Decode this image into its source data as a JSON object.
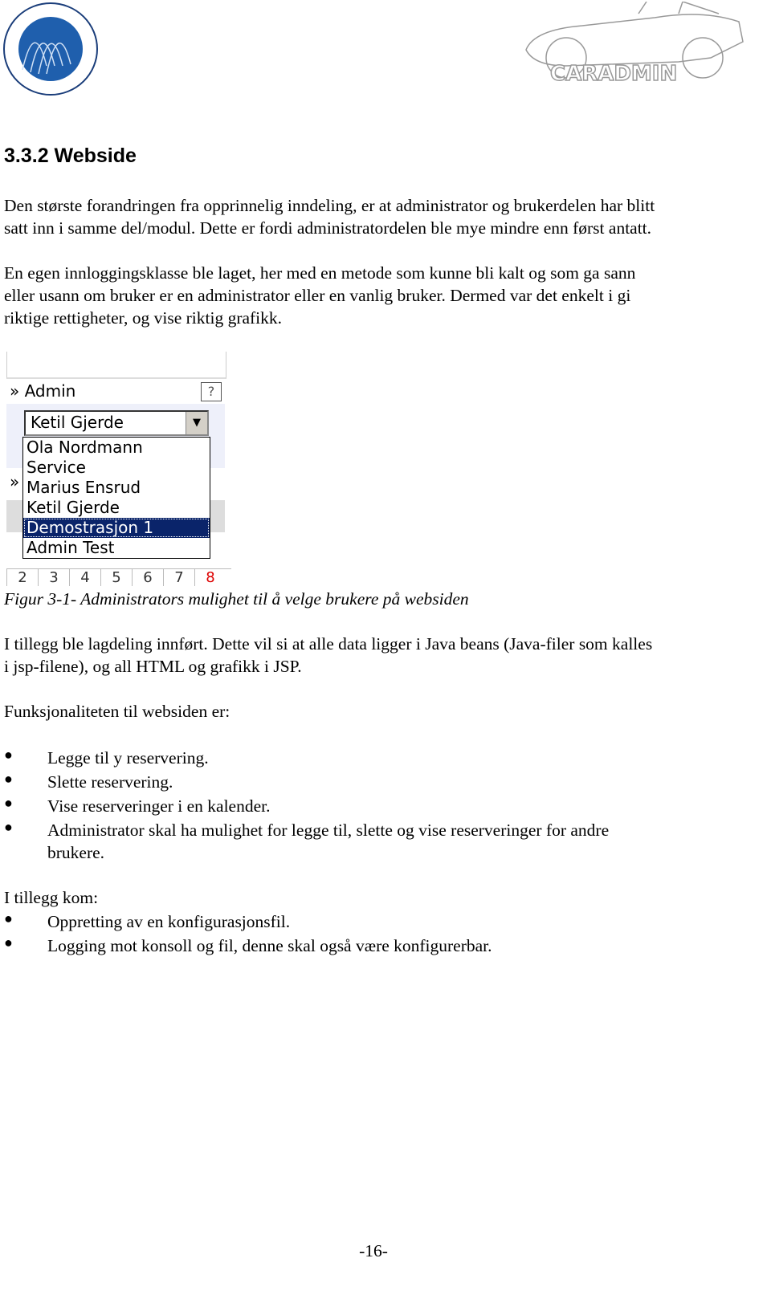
{
  "header": {
    "left_logo": "HØGSKOLEN I GJØVIK",
    "right_logo": "CARADMIN"
  },
  "heading": "3.3.2  Webside",
  "para1": [
    "Den største forandringen fra opprinnelig inndeling, er at administrator og brukerdelen har blitt",
    "satt inn i samme del/modul. Dette er fordi administratordelen ble mye mindre enn først antatt."
  ],
  "para2": [
    "En egen innloggingsklasse ble laget, her med en metode som kunne bli kalt og som ga sann",
    "eller usann om bruker er en administrator eller en vanlig bruker. Dermed var det enkelt i gi",
    "riktige rettigheter, og vise riktig grafikk."
  ],
  "figure": {
    "section_label": "» Admin",
    "help": "?",
    "selected": "Ketil Gjerde",
    "options": [
      "Ola Nordmann",
      "Service",
      "Marius Ensrud",
      "Ketil Gjerde",
      "Demostrasjon 1",
      "Admin Test"
    ],
    "highlighted_index": 4,
    "calendar_days": [
      "2",
      "3",
      "4",
      "5",
      "6",
      "7",
      "8"
    ],
    "accent": "#0a246a"
  },
  "caption": "Figur 3-1- Administrators mulighet til å velge brukere på websiden",
  "para3": [
    "I tillegg ble lagdeling innført. Dette vil si at alle data ligger i Java beans (Java-filer som kalles",
    "i jsp-filene), og all HTML og grafikk i JSP."
  ],
  "para4": "Funksjonaliteten til websiden er:",
  "bullets1": [
    "Legge til y reservering.",
    "Slette reservering.",
    "Vise reserveringer i en kalender.",
    "Administrator skal ha mulighet for legge til, slette og vise reserveringer for andre",
    "brukere."
  ],
  "para5": "I tillegg kom:",
  "bullets2": [
    "Oppretting av en konfigurasjonsfil.",
    "Logging mot konsoll og fil, denne skal også være konfigurerbar."
  ],
  "page_number": "-16-"
}
